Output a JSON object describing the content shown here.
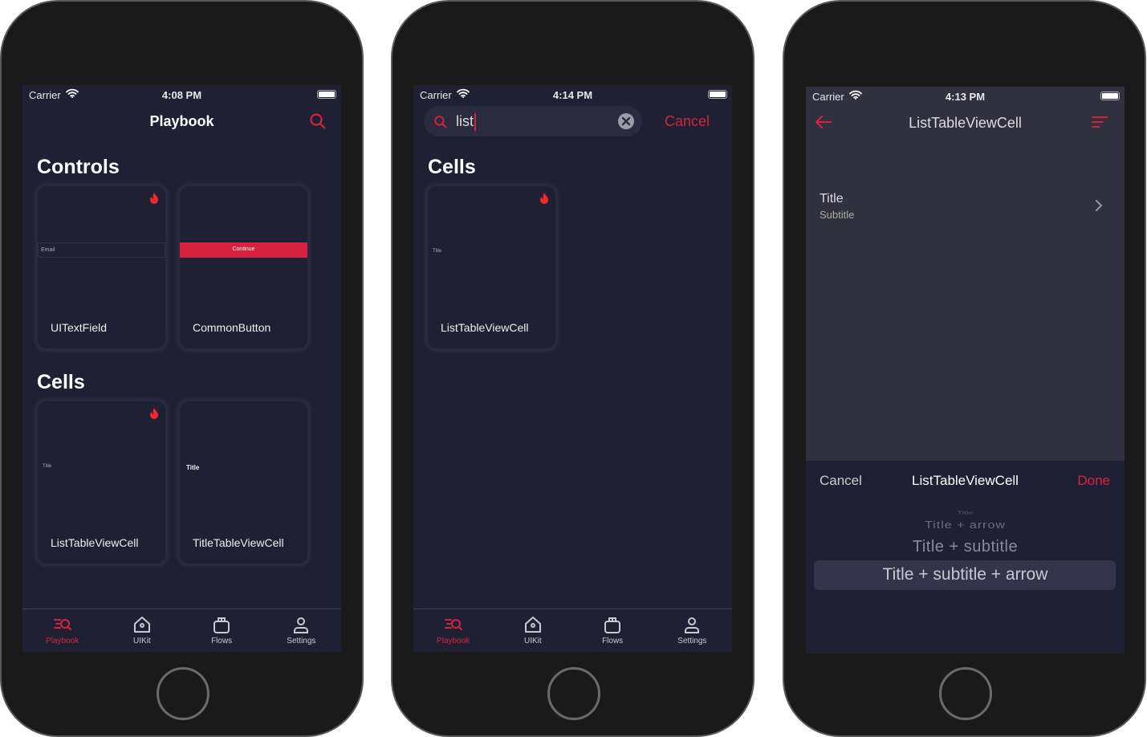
{
  "colors": {
    "accent": "#d7223f",
    "screen_bg": "#1f2033",
    "detail_bg": "#30303e"
  },
  "phones": [
    {
      "status": {
        "carrier": "Carrier",
        "time": "4:08 PM"
      },
      "nav": {
        "title": "Playbook",
        "action_icon": "search-icon"
      },
      "sections": [
        {
          "title": "Controls",
          "cards": [
            {
              "label": "UITextField",
              "preview": "Email",
              "hot": true
            },
            {
              "label": "CommonButton",
              "preview": "Continue",
              "hot": false
            }
          ]
        },
        {
          "title": "Cells",
          "cards": [
            {
              "label": "ListTableViewCell",
              "preview": "Title",
              "hot": true
            },
            {
              "label": "TitleTableViewCell",
              "preview": "Title",
              "hot": false
            }
          ]
        }
      ]
    },
    {
      "status": {
        "carrier": "Carrier",
        "time": "4:14 PM"
      },
      "search": {
        "value": "list",
        "cancel": "Cancel"
      },
      "sections": [
        {
          "title": "Cells",
          "cards": [
            {
              "label": "ListTableViewCell",
              "preview": "Title",
              "hot": true
            }
          ]
        }
      ]
    },
    {
      "status": {
        "carrier": "Carrier",
        "time": "4:13 PM"
      },
      "nav": {
        "title": "ListTableViewCell",
        "back_icon": "arrow-left-icon",
        "action_icon": "filter-icon"
      },
      "row": {
        "title": "Title",
        "subtitle": "Subtitle"
      },
      "picker": {
        "cancel": "Cancel",
        "title": "ListTableViewCell",
        "done": "Done",
        "options": [
          "Title",
          "Title + arrow",
          "Title + subtitle",
          "Title + subtitle + arrow"
        ],
        "selected": "Title + subtitle + arrow"
      }
    }
  ],
  "tabbar": [
    {
      "label": "Playbook",
      "icon": "playbook-search-icon",
      "active": true
    },
    {
      "label": "UIKit",
      "icon": "home-icon",
      "active": false
    },
    {
      "label": "Flows",
      "icon": "bag-icon",
      "active": false
    },
    {
      "label": "Settings",
      "icon": "person-icon",
      "active": false
    }
  ]
}
